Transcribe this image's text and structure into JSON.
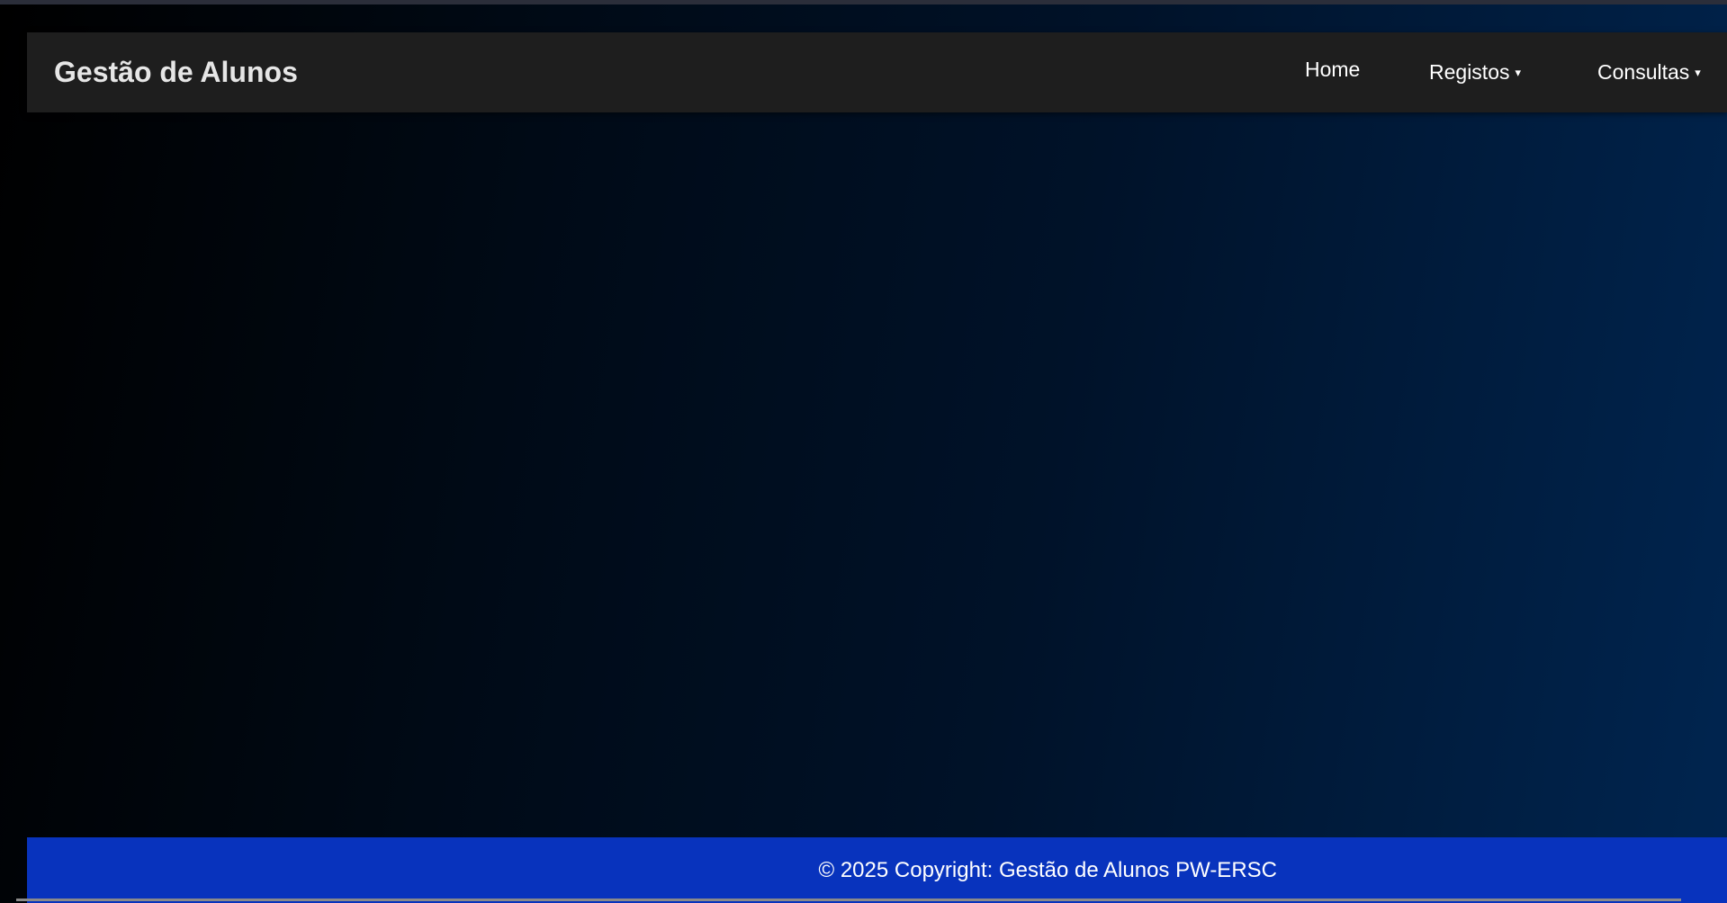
{
  "navbar": {
    "brand": "Gestão de Alunos",
    "items": [
      {
        "label": "Home",
        "dropdown": false
      },
      {
        "label": "Registos",
        "dropdown": true
      },
      {
        "label": "Consultas",
        "dropdown": true
      }
    ],
    "caret_glyph": "▾"
  },
  "footer": {
    "prefix": "© 2025 Copyright:",
    "brand_link": "Gestão de Alunos PW-ERSC"
  },
  "colors": {
    "navbar_bg": "#1e1e1e",
    "footer_bg": "#0833bd",
    "background_gradient_start": "#000000",
    "background_gradient_end": "#002550"
  }
}
